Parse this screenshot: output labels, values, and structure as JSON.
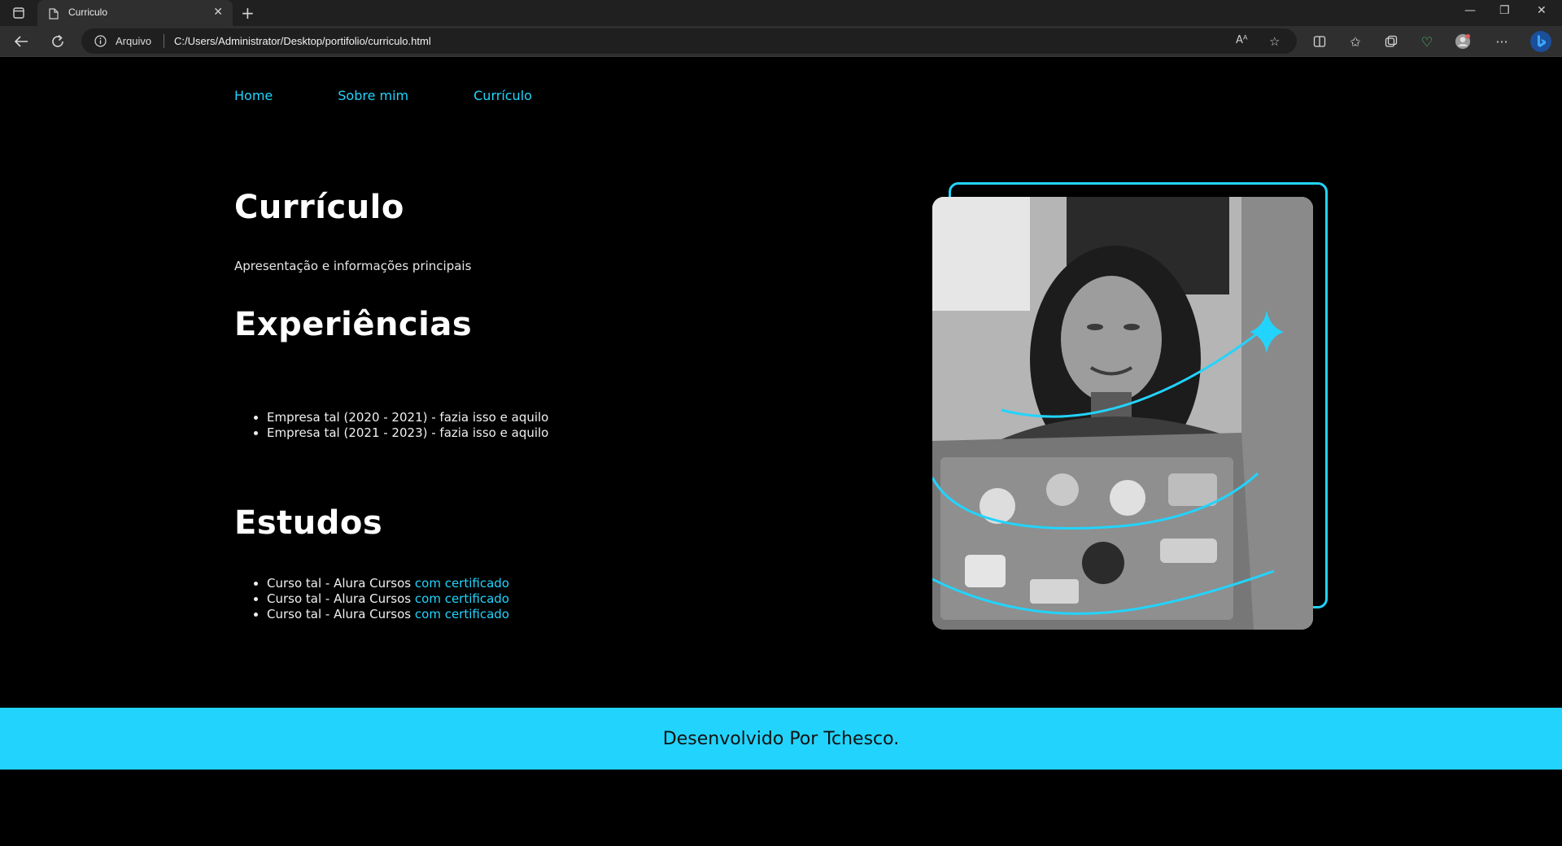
{
  "browser": {
    "tab_title": "Curriculo",
    "site_label": "Arquivo",
    "url": "C:/Users/Administrator/Desktop/portifolio/curriculo.html"
  },
  "nav": {
    "home": "Home",
    "about": "Sobre mim",
    "resume": "Currículo"
  },
  "main": {
    "title": "Currículo",
    "subtitle": "Apresentação e informações principais",
    "experiences_heading": "Experiências",
    "experiences": [
      "Empresa tal (2020 - 2021) - fazia isso e aquilo",
      "Empresa tal (2021 - 2023) - fazia isso e aquilo"
    ],
    "studies_heading": "Estudos",
    "studies": [
      {
        "text": "Curso tal - Alura Cursos ",
        "link": "com certificado"
      },
      {
        "text": "Curso tal - Alura Cursos ",
        "link": "com certificado"
      },
      {
        "text": "Curso tal - Alura Cursos ",
        "link": "com certificado"
      }
    ]
  },
  "footer": {
    "text": "Desenvolvido Por Tchesco."
  },
  "colors": {
    "accent": "#22d4fd",
    "background": "#000000",
    "chrome": "#2f2f2f"
  },
  "icons": [
    "tab-actions-icon",
    "page-icon",
    "close-icon",
    "plus-icon",
    "minimize-icon",
    "restore-icon",
    "back-icon",
    "refresh-icon",
    "info-icon",
    "read-aloud-icon",
    "favorite-icon",
    "split-screen-icon",
    "favorites-icon",
    "collections-icon",
    "health-icon",
    "profile-icon",
    "more-icon",
    "bing-icon",
    "sparkle-icon"
  ]
}
